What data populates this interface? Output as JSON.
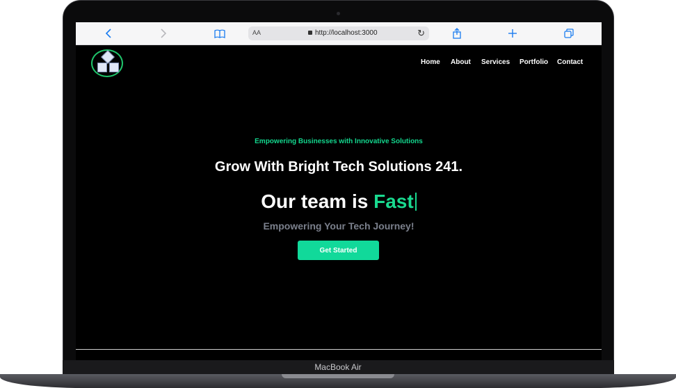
{
  "device": {
    "label": "MacBook Air"
  },
  "browser": {
    "text_size_label": "AA",
    "url": "http://localhost:3000",
    "icons": [
      "back-icon",
      "forward-icon",
      "bookmarks-icon",
      "share-icon",
      "new-tab-icon",
      "tabs-icon",
      "reload-icon",
      "lock-icon"
    ]
  },
  "nav": {
    "items": [
      {
        "label": "Home"
      },
      {
        "label": "About"
      },
      {
        "label": "Services"
      },
      {
        "label": "Portfolio"
      },
      {
        "label": "Contact"
      }
    ]
  },
  "hero": {
    "tagline": "Empowering Businesses with Innovative Solutions",
    "title": "Grow With Bright Tech Solutions 241.",
    "typing_prefix": "Our team is",
    "typing_word": "Fast",
    "subtitle": "Empowering Your Tech Journey!",
    "cta_label": "Get Started"
  },
  "colors": {
    "accent": "#13d78e",
    "background": "#000000",
    "logo_ring": "#1fc46b"
  }
}
